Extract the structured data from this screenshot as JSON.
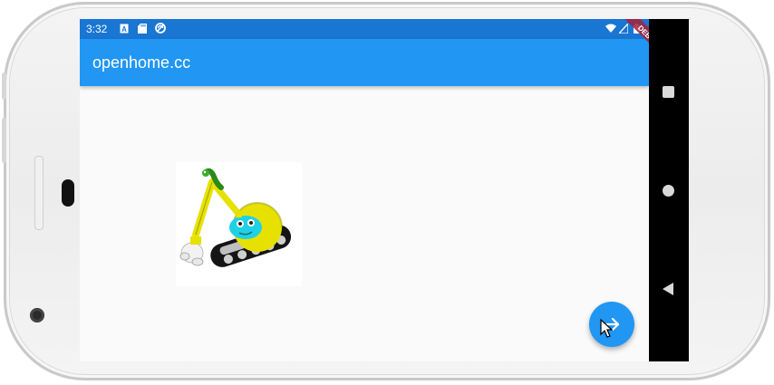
{
  "status_bar": {
    "time": "3:32",
    "icons": [
      "a-icon",
      "sd-card-icon",
      "sync-icon",
      "wifi-icon",
      "signal-icon",
      "battery-icon"
    ]
  },
  "app_bar": {
    "title": "openhome.cc"
  },
  "debug_banner": {
    "label": "DEBUG"
  },
  "navigation": {
    "buttons": [
      "recents-button",
      "home-button",
      "back-button"
    ]
  },
  "fab": {
    "icon": "arrow-right-icon"
  },
  "colors": {
    "status_bar": "#1976d2",
    "app_bar": "#2196f3",
    "fab": "#2196f3",
    "debug_banner": "#a3223a"
  }
}
